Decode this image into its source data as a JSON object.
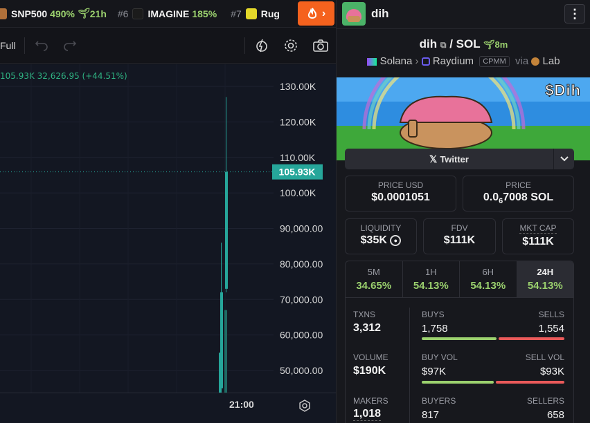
{
  "ticker": [
    {
      "rank": "",
      "name": "SNP500",
      "pct": "490%",
      "age": "21h",
      "logo_color": "#b0703a"
    },
    {
      "rank": "#6",
      "name": "IMAGINE",
      "pct": "185%",
      "age": "",
      "logo_color": "#1b1b1b"
    },
    {
      "rank": "#7",
      "name": "Rug",
      "pct": "",
      "age": "",
      "logo_color": "#e4d82a"
    }
  ],
  "chart": {
    "toolbar_full": "Full",
    "legend": "105.93K  32,626.95 (+44.51%)",
    "x_time": "21:00",
    "price_marker": "105.93K",
    "y_ticks": [
      "130.00K",
      "120.00K",
      "110.00K",
      "100.00K",
      "90,000.00",
      "80,000.00",
      "70,000.00",
      "60,000.00",
      "50,000.00"
    ]
  },
  "chart_data": {
    "type": "candlestick",
    "y_ticks": [
      130000,
      120000,
      110000,
      100000,
      90000,
      80000,
      70000,
      60000,
      50000
    ],
    "last_price": 105930,
    "candles": [
      {
        "open": 40000,
        "close": 55000,
        "high": 55000,
        "low": 40000,
        "dir": "up"
      },
      {
        "open": 45000,
        "close": 72000,
        "high": 86000,
        "low": 40000,
        "dir": "up"
      },
      {
        "open": 67000,
        "close": 40000,
        "high": 67000,
        "low": 40000,
        "dir": "down"
      },
      {
        "open": 73000,
        "close": 105930,
        "high": 127000,
        "low": 72000,
        "dir": "up"
      }
    ],
    "colors": {
      "up": "#26a69a",
      "down": "#1e6b64"
    }
  },
  "header": {
    "token": "dih",
    "menu": "⋮"
  },
  "pair": {
    "base": "dih",
    "quote": "SOL",
    "age": "8m"
  },
  "chain": {
    "chain": "Solana",
    "dex": "Raydium",
    "tag": "CPMM",
    "via": "via",
    "lab": "Lab"
  },
  "banner": {
    "title": "$Dih"
  },
  "social": {
    "twitter": "Twitter"
  },
  "price": {
    "usd_label": "PRICE USD",
    "usd_value": "$0.0001051",
    "sol_label": "PRICE",
    "sol_prefix": "0.0",
    "sol_sub": "6",
    "sol_rest": "7008 SOL"
  },
  "metrics": {
    "liquidity_label": "LIQUIDITY",
    "liquidity_value": "$35K",
    "fdv_label": "FDV",
    "fdv_value": "$111K",
    "mcap_label": "MKT CAP",
    "mcap_value": "$111K"
  },
  "tabs": [
    {
      "label": "5M",
      "pct": "34.65%"
    },
    {
      "label": "1H",
      "pct": "54.13%"
    },
    {
      "label": "6H",
      "pct": "54.13%"
    },
    {
      "label": "24H",
      "pct": "54.13%"
    }
  ],
  "stats": {
    "txns_label": "TXNS",
    "txns": "3,312",
    "buys_label": "BUYS",
    "buys": "1,758",
    "sells_label": "SELLS",
    "sells": "1,554",
    "volume_label": "VOLUME",
    "volume": "$190K",
    "buyvol_label": "BUY VOL",
    "buyvol": "$97K",
    "sellvol_label": "SELL VOL",
    "sellvol": "$93K",
    "makers_label": "MAKERS",
    "makers": "1,018",
    "buyers_label": "BUYERS",
    "buyers": "817",
    "sellers_label": "SELLERS",
    "sellers": "658",
    "buy_ratio": 0.53,
    "buyvol_ratio": 0.51
  }
}
